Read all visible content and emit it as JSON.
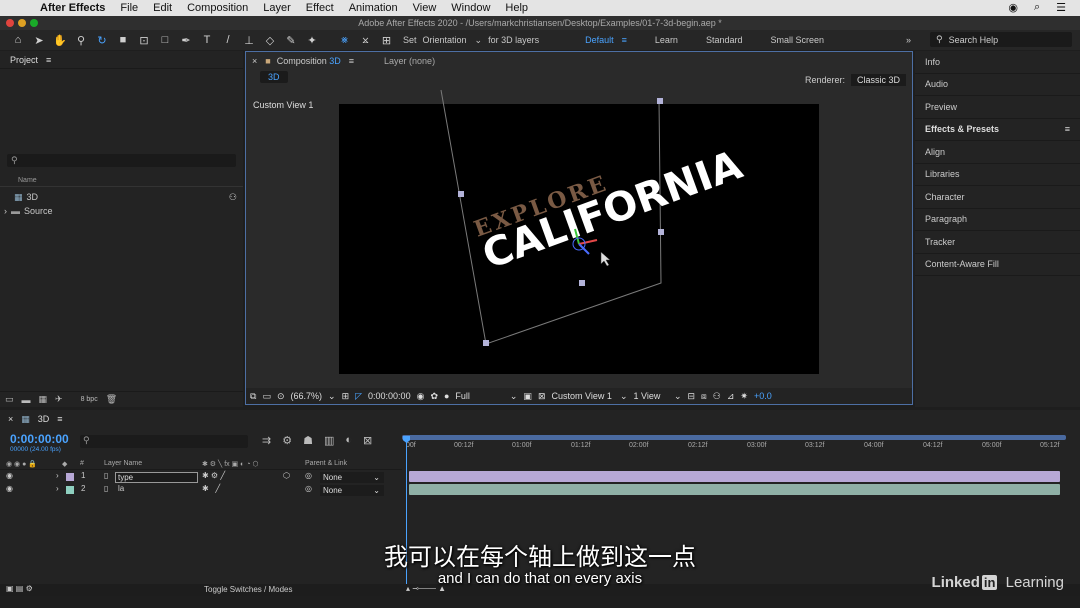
{
  "menubar": {
    "app": "After Effects",
    "items": [
      "File",
      "Edit",
      "Composition",
      "Layer",
      "Effect",
      "Animation",
      "View",
      "Window",
      "Help"
    ]
  },
  "titlebar": {
    "title": "Adobe After Effects 2020 - /Users/markchristiansen/Desktop/Examples/01-7-3d-begin.aep *"
  },
  "toolbar": {
    "set_label": "Set",
    "orientation": "Orientation",
    "for3d": "for 3D layers",
    "workspaces": [
      "Default",
      "Learn",
      "Standard",
      "Small Screen"
    ],
    "search_help": "Search Help"
  },
  "project": {
    "title": "Project",
    "col_name": "Name",
    "items": [
      "3D",
      "Source"
    ],
    "bpc": "8 bpc"
  },
  "comp": {
    "tab_label": "Composition",
    "tab_name": "3D",
    "layer_tab": "Layer (none)",
    "chip": "3D",
    "renderer_label": "Renderer:",
    "renderer_value": "Classic 3D",
    "view_name": "Custom View 1",
    "text_explore": "EXPLORE",
    "text_california": "CALIFORNIA",
    "zoom": "(66.7%)",
    "timecode": "0:00:00:00",
    "resolution": "Full",
    "view": "Custom View 1",
    "views": "1 View",
    "exposure": "+0.0"
  },
  "right_panels": [
    "Info",
    "Audio",
    "Preview",
    "Effects & Presets",
    "Align",
    "Libraries",
    "Character",
    "Paragraph",
    "Tracker",
    "Content-Aware Fill"
  ],
  "timeline": {
    "comp_name": "3D",
    "timecode": "0:00:00:00",
    "frames": "00000 (24.00 fps)",
    "ruler": [
      "00f",
      "00:12f",
      "01:00f",
      "01:12f",
      "02:00f",
      "02:12f",
      "03:00f",
      "03:12f",
      "04:00f",
      "04:12f",
      "05:00f",
      "05:12f"
    ],
    "col_layer_name": "Layer Name",
    "col_num": "#",
    "col_parent": "Parent & Link",
    "layers": [
      {
        "num": "1",
        "name": "type",
        "parent": "None"
      },
      {
        "num": "2",
        "name": "la",
        "parent": "None"
      }
    ],
    "toggle": "Toggle Switches / Modes"
  },
  "subtitle": {
    "cn": "我可以在每个轴上做到这一点",
    "en": "and I can do that on every axis"
  },
  "watermark": {
    "brand": "Linked",
    "in": "in",
    "learning": "Learning"
  },
  "colors": {
    "accent": "#4aa3ff",
    "layer1": "#b7a8d6",
    "layer2": "#8fb0a6",
    "text_brown": "#7a5a44"
  }
}
